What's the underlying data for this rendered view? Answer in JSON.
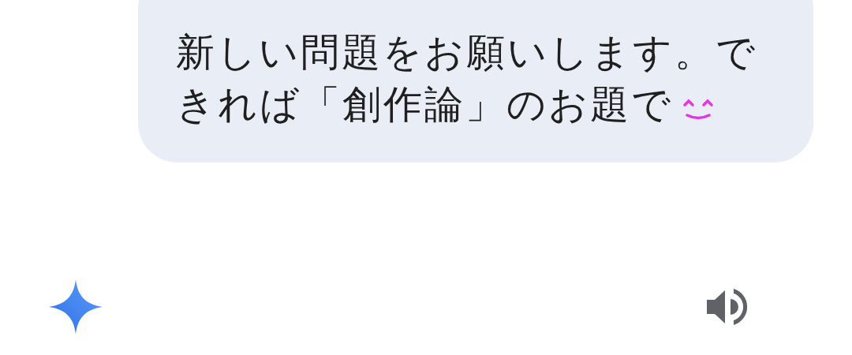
{
  "user_message": {
    "text": "新しい問題をお願いします。できれば「創作論」のお題で"
  }
}
